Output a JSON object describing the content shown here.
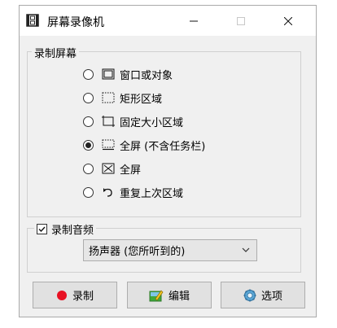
{
  "window": {
    "title": "屏幕录像机"
  },
  "record_group": {
    "legend": "录制屏幕",
    "options": [
      {
        "label": "窗口或对象",
        "icon": "window-frame-icon",
        "selected": false
      },
      {
        "label": "矩形区域",
        "icon": "dotted-rect-icon",
        "selected": false
      },
      {
        "label": "固定大小区域",
        "icon": "fixed-size-rect-icon",
        "selected": false
      },
      {
        "label": "全屏 (不含任务栏)",
        "icon": "fullscreen-no-taskbar-icon",
        "selected": true
      },
      {
        "label": "全屏",
        "icon": "fullscreen-icon",
        "selected": false
      },
      {
        "label": "重复上次区域",
        "icon": "repeat-arrow-icon",
        "selected": false
      }
    ]
  },
  "audio_group": {
    "legend": "录制音频",
    "checked": true,
    "device_selected": "扬声器 (您所听到的)"
  },
  "buttons": {
    "record": "录制",
    "edit": "编辑",
    "options": "选项"
  },
  "colors": {
    "record_dot": "#e81123"
  }
}
